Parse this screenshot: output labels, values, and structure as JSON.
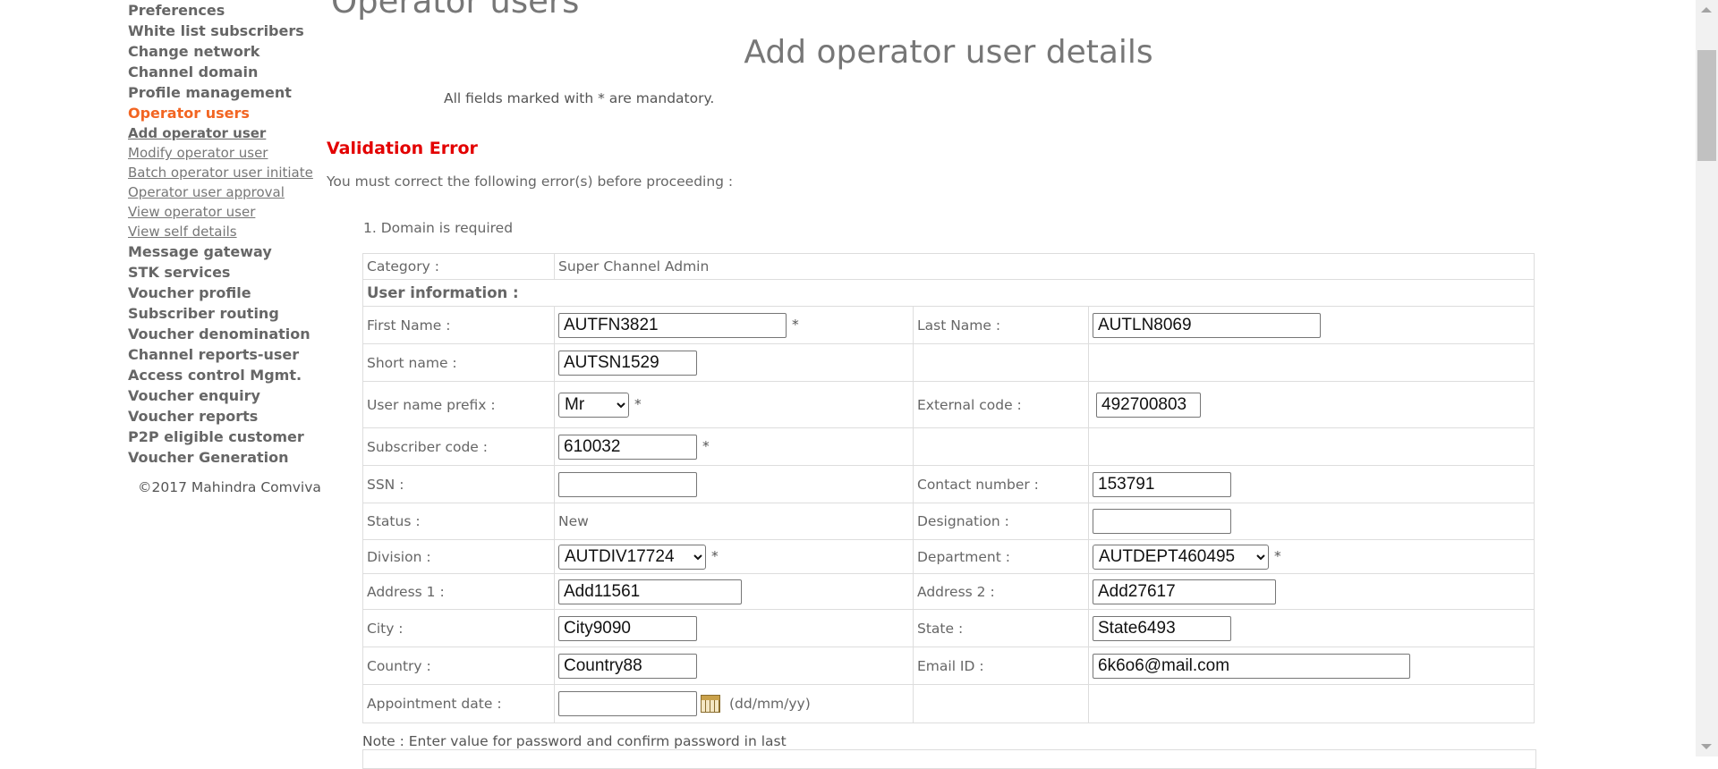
{
  "sidebar": {
    "groups_top": [
      "Preferences",
      "White list subscribers",
      "Change network",
      "Channel domain",
      "Profile management"
    ],
    "active_group": "Operator users",
    "sub_items": [
      "Add operator user",
      "Modify operator user",
      "Batch operator user initiate",
      "Operator user approval",
      "View operator user",
      "View self details"
    ],
    "groups_bottom": [
      "Message gateway",
      "STK services",
      "Voucher profile",
      "Subscriber routing",
      "Voucher denomination",
      "Channel reports-user",
      "Access control Mgmt.",
      "Voucher enquiry",
      "Voucher reports",
      "P2P eligible customer",
      "Voucher Generation"
    ],
    "copyright": "©2017 Mahindra Comviva"
  },
  "main": {
    "page_heading": "Operator users",
    "form_title": "Add operator user details",
    "mandatory_note": "All fields marked with * are mandatory.",
    "validation_title": "Validation Error",
    "validation_intro": "You must correct the following error(s) before proceeding :",
    "errors": [
      "1. Domain is required"
    ]
  },
  "form": {
    "category_label": "Category :",
    "category_value": "Super Channel Admin",
    "section_user_info": "User information :",
    "first_name_label": "First Name :",
    "first_name": "AUTFN3821",
    "last_name_label": "Last Name :",
    "last_name": "AUTLN8069",
    "short_name_label": "Short name :",
    "short_name": "AUTSN1529",
    "prefix_label": "User name prefix :",
    "prefix_value": "Mr",
    "external_code_label": "External code :",
    "external_code": "492700803",
    "subscriber_code_label": "Subscriber code :",
    "subscriber_code": "610032",
    "ssn_label": "SSN :",
    "ssn": "",
    "contact_number_label": "Contact number :",
    "contact_number": "153791",
    "status_label": "Status :",
    "status_value": "New",
    "designation_label": "Designation :",
    "designation": "",
    "division_label": "Division :",
    "division_value": "AUTDIV17724",
    "department_label": "Department :",
    "department_value": "AUTDEPT460495",
    "address1_label": "Address 1 :",
    "address1": "Add11561",
    "address2_label": "Address 2 :",
    "address2": "Add27617",
    "city_label": "City :",
    "city": "City9090",
    "state_label": "State :",
    "state": "State6493",
    "country_label": "Country :",
    "country": "Country88",
    "email_label": "Email ID :",
    "email": "6k6o6@mail.com",
    "appointment_label": "Appointment date :",
    "appointment_date": "",
    "date_format_hint": "(dd/mm/yy)",
    "required_marker": "*",
    "password_note": "Note : Enter value for password and confirm password in last"
  }
}
